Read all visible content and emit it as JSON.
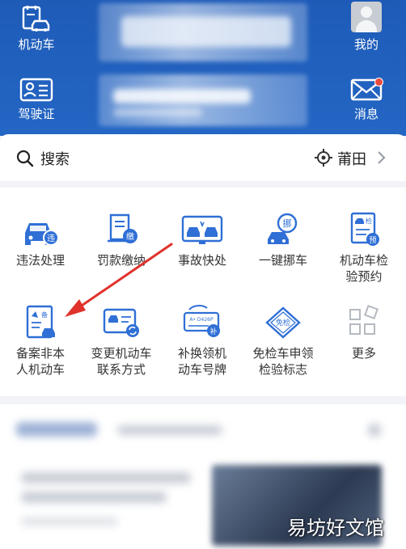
{
  "header": {
    "buttons": {
      "vehicle": "机动车",
      "license": "驾驶证",
      "mine": "我的",
      "messages": "消息"
    }
  },
  "search": {
    "label": "搜索",
    "city": "莆田",
    "icons": [
      "search-icon",
      "location-target-icon",
      "chevron-right-icon"
    ]
  },
  "services": [
    {
      "label": "违法处理",
      "icon": "car-violation-icon"
    },
    {
      "label": "罚款缴纳",
      "icon": "fine-scroll-icon",
      "badge": "缴"
    },
    {
      "label": "事故快处",
      "icon": "accident-cars-icon"
    },
    {
      "label": "一键挪车",
      "icon": "move-car-icon",
      "badge": "挪"
    },
    {
      "label": "机动车检\n验预约",
      "icon": "inspection-appointment-icon",
      "badge": "检",
      "badge2": "预"
    },
    {
      "label": "备案非本\n人机动车",
      "icon": "register-other-vehicle-icon",
      "badge": "备"
    },
    {
      "label": "变更机动车\n联系方式",
      "icon": "change-contact-card-icon"
    },
    {
      "label": "补换领机\n动车号牌",
      "icon": "replace-plate-icon",
      "plate": "A• D426P",
      "badge": "补"
    },
    {
      "label": "免检车申领\n检验标志",
      "icon": "exempt-inspection-icon",
      "badge": "免检"
    },
    {
      "label": "更多",
      "icon": "more-grid-icon"
    }
  ],
  "watermark": "易坊好文馆",
  "colors": {
    "header_blue": "#2466c4",
    "icon_blue": "#2f6fd6",
    "arrow_red": "#e0322c",
    "notify_red": "#e84a3d"
  }
}
